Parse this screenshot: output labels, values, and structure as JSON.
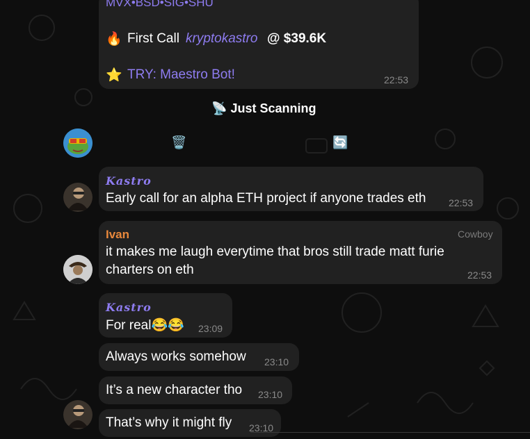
{
  "top_message": {
    "tickers": "MVX•BSD•SIG•SHU",
    "first_call_prefix": "First Call",
    "first_call_user": "kryptokastro",
    "first_call_suffix": "@ $39.6K",
    "try_text": "TRY: Maestro Bot!",
    "time": "22:53",
    "fire_emoji": "🔥",
    "star_emoji": "⭐"
  },
  "bot_buttons": {
    "scanning_label": "Just Scanning",
    "scanning_icon": "📡",
    "trash_icon": "🗑️",
    "refresh_icon": "🔄"
  },
  "messages": [
    {
      "sender": "Kastro",
      "text": "Early call for an alpha ETH project if anyone trades eth",
      "time": "22:53"
    },
    {
      "sender": "Ivan",
      "rank": "Cowboy",
      "line1": "it makes me laugh everytime that bros still trade matt furie",
      "line2": "charters on eth",
      "time": "22:53"
    },
    {
      "sender": "Kastro",
      "text": "For real😂😂",
      "time": "23:09"
    },
    {
      "text": "Always works somehow",
      "time": "23:10"
    },
    {
      "text": "It’s a new character tho",
      "time": "23:10"
    },
    {
      "text": "That’s why it might fly",
      "time": "23:10"
    }
  ],
  "colors": {
    "background": "#0e0e0e",
    "bubble": "#212121",
    "link": "#8e7cf0",
    "sender_orange": "#e8883c"
  }
}
